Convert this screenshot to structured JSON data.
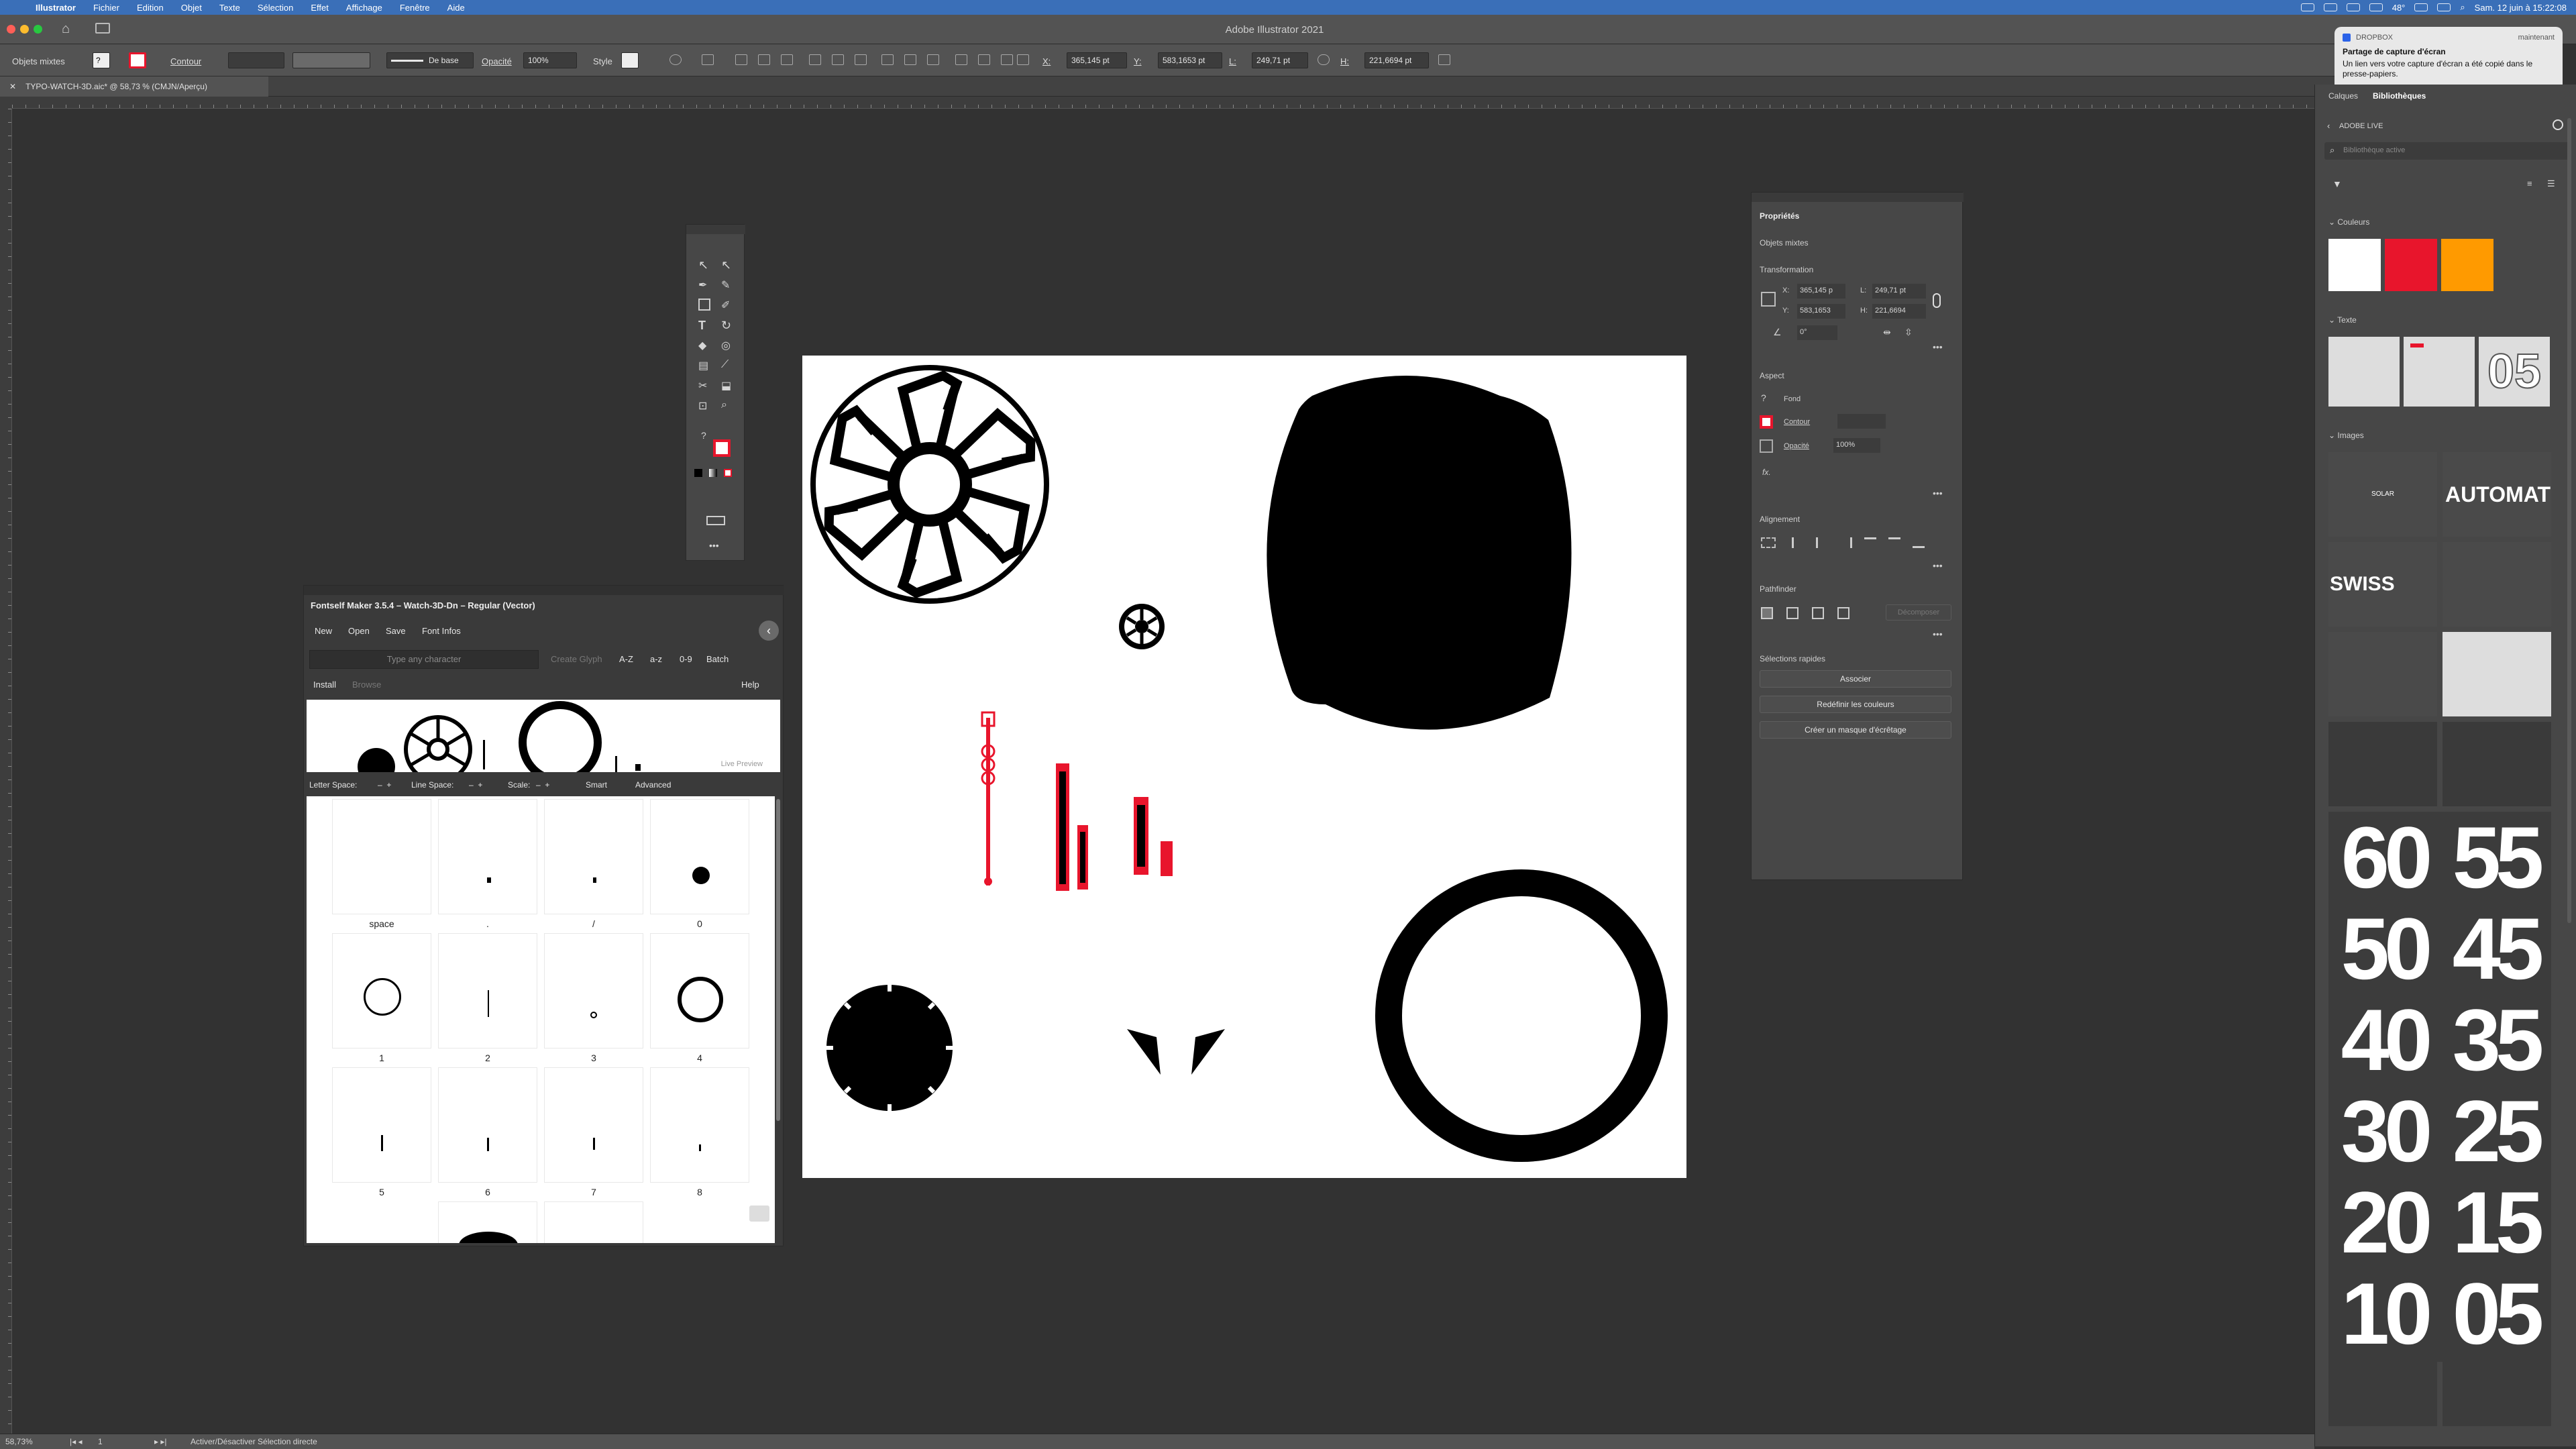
{
  "menubar": {
    "app_name": "Illustrator",
    "items": [
      "Fichier",
      "Edition",
      "Objet",
      "Texte",
      "Sélection",
      "Effet",
      "Affichage",
      "Fenêtre",
      "Aide"
    ],
    "datetime": "Sam. 12 juin à 15:22:08",
    "temperature": "48°"
  },
  "window": {
    "title": "Adobe Illustrator 2021"
  },
  "controlbar": {
    "selection_label": "Objets mixtes",
    "stroke_label": "Contour",
    "stroke_style": "De base",
    "opacity_label": "Opacité",
    "opacity_value": "100%",
    "style_label": "Style",
    "x_label": "X:",
    "x_value": "365,145 pt",
    "y_label": "Y:",
    "y_value": "583,1653 pt",
    "w_label": "L:",
    "w_value": "249,71 pt",
    "h_label": "H:",
    "h_value": "221,6694 pt"
  },
  "document": {
    "tab_title": "TYPO-WATCH-3D.aic* @ 58,73 % (CMJN/Aperçu)"
  },
  "fontself": {
    "title": "Fontself Maker 3.5.4 – Watch-3D-Dn – Regular (Vector)",
    "menu": [
      "New",
      "Open",
      "Save",
      "Font Infos"
    ],
    "input_placeholder": "Type any character",
    "create_glyph": "Create Glyph",
    "batch_buttons": [
      "A-Z",
      "a-z",
      "0-9",
      "Batch"
    ],
    "tabs": [
      "Install",
      "Browse"
    ],
    "help": "Help",
    "live_preview": "Live Preview",
    "spacing": {
      "letter": "Letter Space:",
      "line": "Line Space:",
      "scale": "Scale:",
      "smart": "Smart",
      "advanced": "Advanced"
    },
    "glyphs": [
      {
        "label": "space"
      },
      {
        "label": "."
      },
      {
        "label": "/"
      },
      {
        "label": "0"
      },
      {
        "label": "1"
      },
      {
        "label": "2"
      },
      {
        "label": "3"
      },
      {
        "label": "4"
      },
      {
        "label": "5"
      },
      {
        "label": "6"
      },
      {
        "label": "7"
      },
      {
        "label": "8"
      }
    ]
  },
  "properties": {
    "title": "Propriétés",
    "selection": "Objets mixtes",
    "transform_title": "Transformation",
    "x_label": "X:",
    "x_value": "365,145 p",
    "y_label": "Y:",
    "y_value": "583,1653",
    "w_label": "L:",
    "w_value": "249,71 pt",
    "h_label": "H:",
    "h_value": "221,6694",
    "angle": "0°",
    "aspect_title": "Aspect",
    "fill_label": "Fond",
    "stroke_label": "Contour",
    "opacity_label": "Opacité",
    "opacity_value": "100%",
    "align_title": "Alignement",
    "pathfinder_title": "Pathfinder",
    "expand_label": "Décomposer",
    "quick_title": "Sélections rapides",
    "buttons": [
      "Associer",
      "Redéfinir les couleurs",
      "Créer un masque d'écrêtage"
    ]
  },
  "libraries": {
    "tabs": [
      "Calques",
      "Bibliothèques"
    ],
    "library_name": "ADOBE LIVE",
    "search_placeholder": "Bibliothèque active",
    "colors_title": "Couleurs",
    "colors": [
      "#ffffff",
      "#e8152c",
      "#ff9a00"
    ],
    "text_title": "Texte",
    "text_thumb": "05",
    "images_title": "Images",
    "image_texts": [
      "SOLAR",
      "AUTOMATIC",
      "SWISS MADE"
    ],
    "numbers": [
      "60",
      "55",
      "50",
      "45",
      "40",
      "35",
      "30",
      "25",
      "20",
      "15",
      "10",
      "05"
    ]
  },
  "notification": {
    "app": "DROPBOX",
    "time": "maintenant",
    "title": "Partage de capture d'écran",
    "body": "Un lien vers votre capture d'écran a été copié dans le presse-papiers."
  },
  "status": {
    "zoom": "58,73%",
    "page": "1",
    "message": "Activer/Désactiver Sélection directe"
  },
  "accent": "#e8152c"
}
